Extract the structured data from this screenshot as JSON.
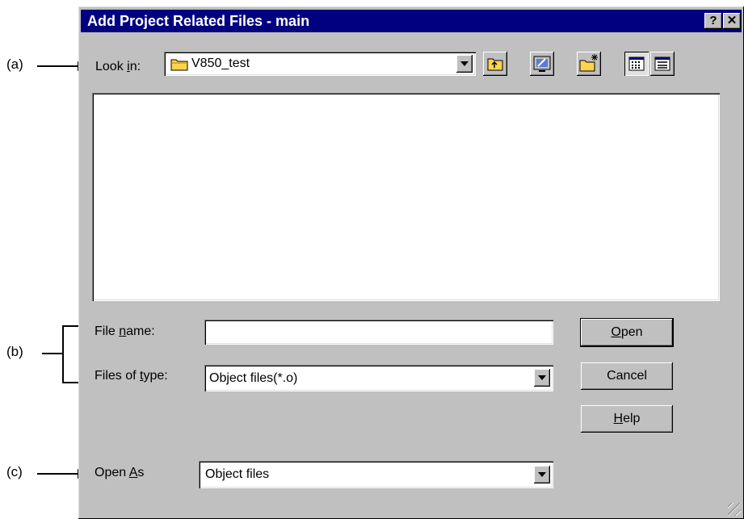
{
  "annotations": {
    "a": "(a)",
    "b": "(b)",
    "c": "(c)"
  },
  "dialog": {
    "title": "Add Project Related Files - main",
    "help_glyph": "?",
    "close_glyph": "✕"
  },
  "look_in": {
    "label_pre": "Look ",
    "label_u": "i",
    "label_post": "n:",
    "value": "V850_test"
  },
  "toolbar": {
    "icons": [
      "up-folder-icon",
      "desktop-icon",
      "new-folder-icon",
      "list-view-icon",
      "details-view-icon"
    ]
  },
  "file_name": {
    "label_pre": "File ",
    "label_u": "n",
    "label_post": "ame:",
    "value": ""
  },
  "files_of_type": {
    "label_pre": "Files of ",
    "label_u": "t",
    "label_post": "ype:",
    "value": "Object files(*.o)"
  },
  "open_as": {
    "label_pre": "Open ",
    "label_u": "A",
    "label_post": "s",
    "value": "Object files"
  },
  "buttons": {
    "open_u": "O",
    "open_rest": "pen",
    "cancel": "Cancel",
    "help_u": "H",
    "help_rest": "elp"
  },
  "colors": {
    "titlebar": "#000080",
    "face": "#c0c0c0",
    "folder": "#ffd34d"
  }
}
